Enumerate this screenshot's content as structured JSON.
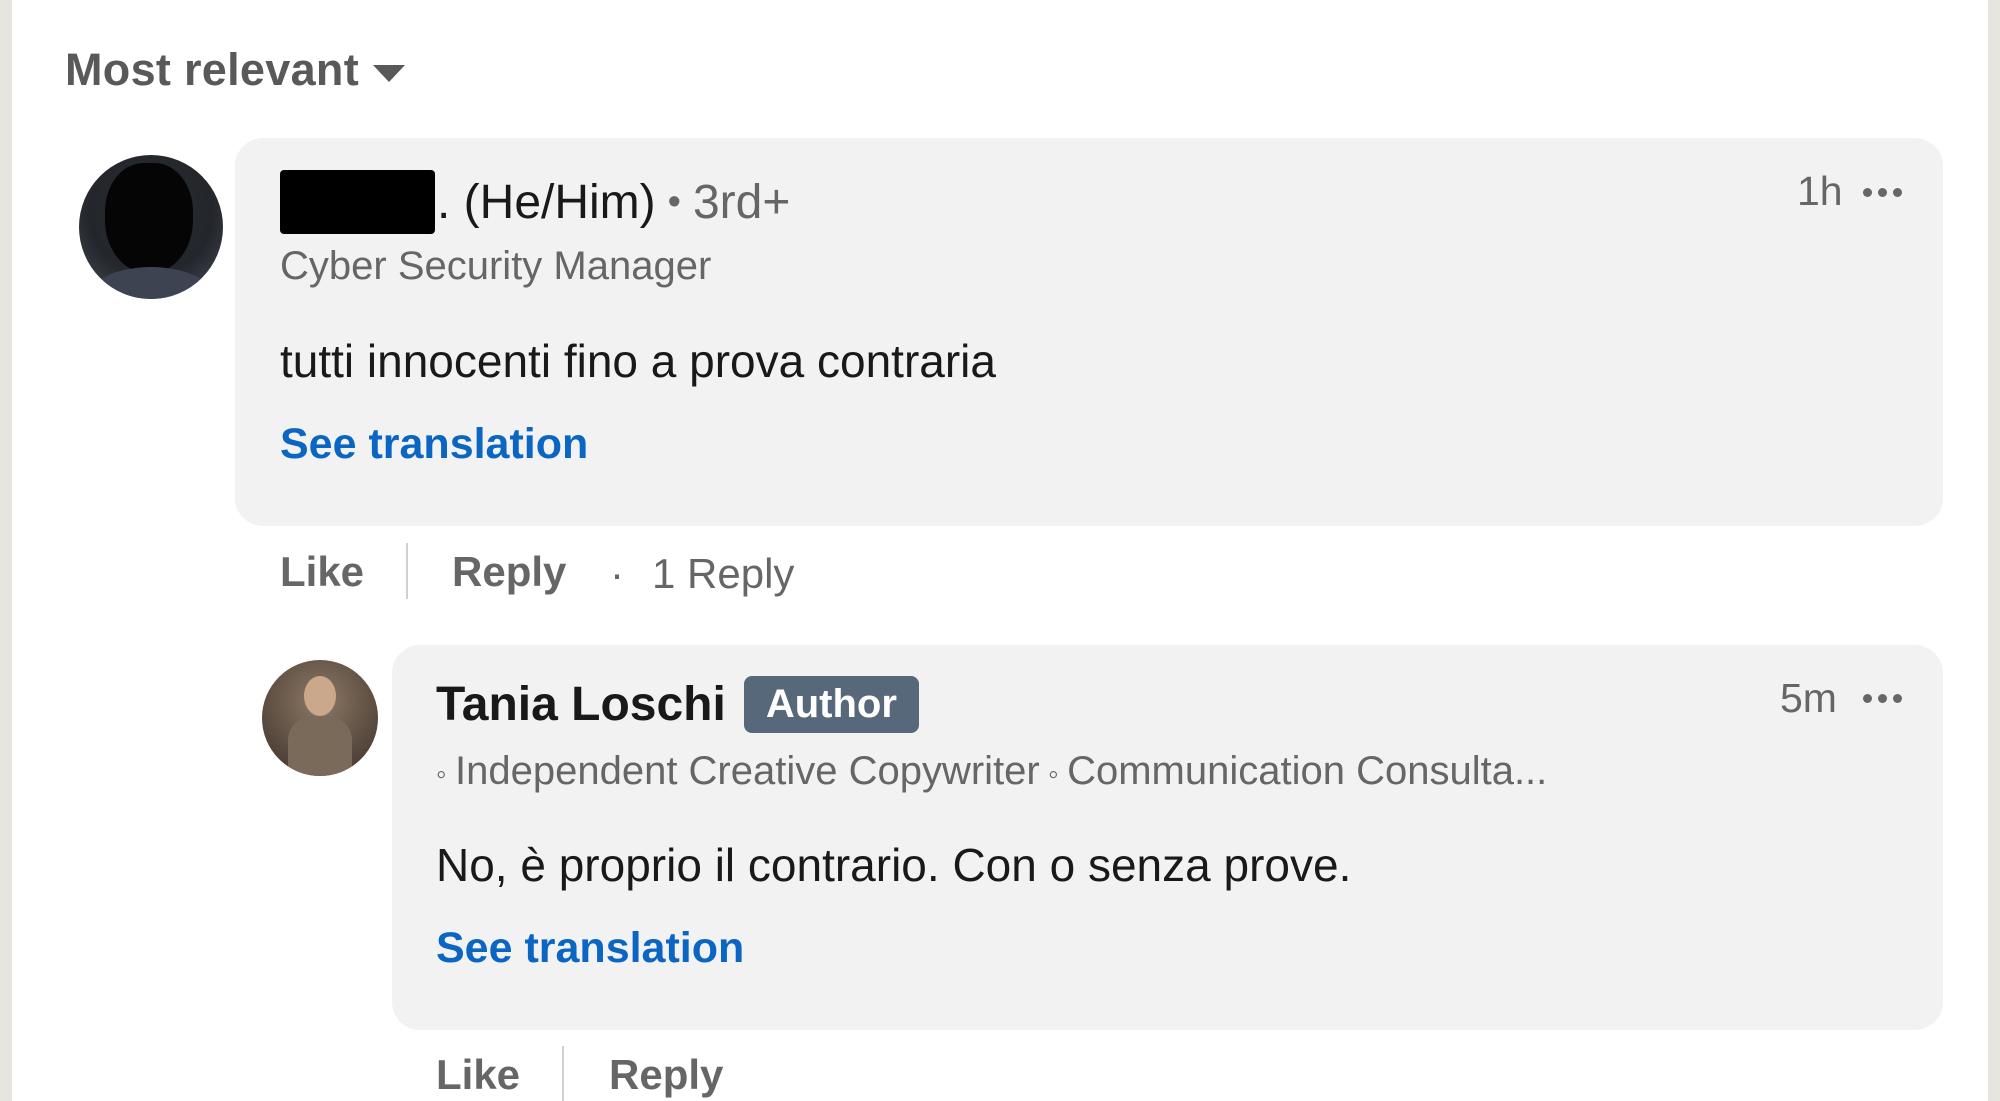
{
  "sort": {
    "label": "Most relevant"
  },
  "comments": [
    {
      "author_suffix": ". (He/Him)",
      "degree": "3rd+",
      "headline": "Cyber Security Manager",
      "text": "tutti innocenti fino a prova contraria",
      "see_translation": "See translation",
      "time": "1h",
      "actions": {
        "like": "Like",
        "reply": "Reply",
        "reply_count": "1 Reply"
      },
      "icons": {
        "avatar": "user-avatar",
        "more": "ellipsis-icon"
      }
    }
  ],
  "reply": {
    "author": "Tania Loschi",
    "badge": "Author",
    "headline_1": "Independent Creative Copywriter",
    "headline_2": "Communication Consulta...",
    "text": "No, è proprio il contrario. Con o senza prove.",
    "see_translation": "See translation",
    "time": "5m",
    "actions": {
      "like": "Like",
      "reply": "Reply"
    }
  },
  "colors": {
    "link": "#0a66c2",
    "bubble": "#f2f2f2",
    "badge": "#56687a",
    "muted": "#666666"
  }
}
